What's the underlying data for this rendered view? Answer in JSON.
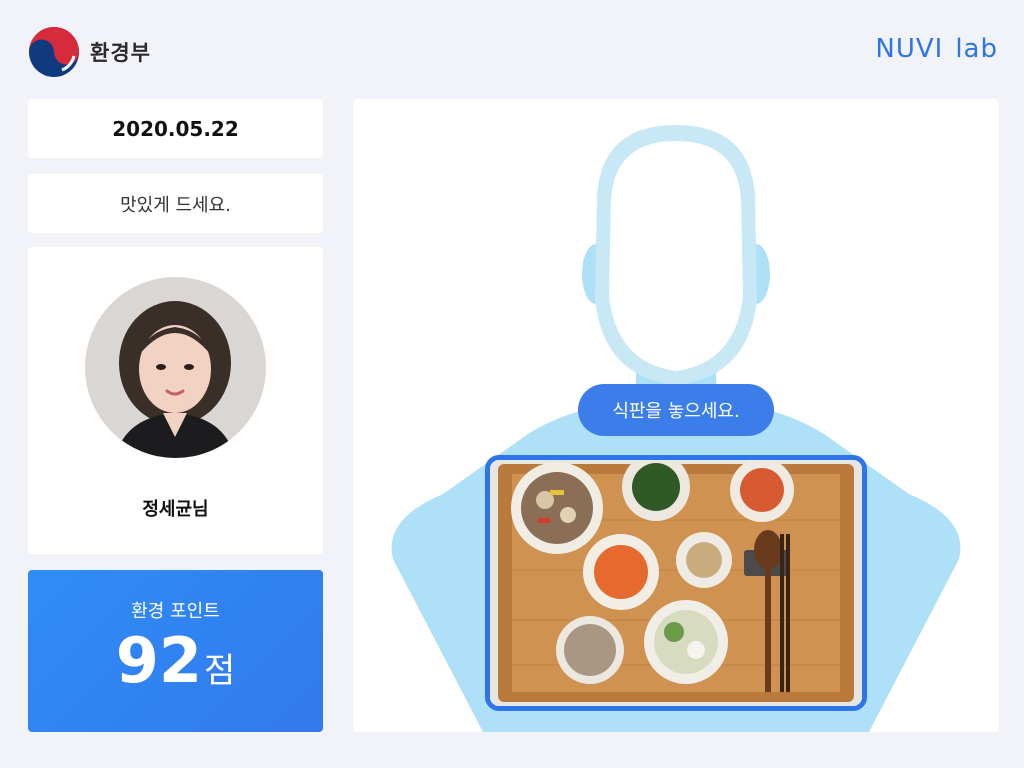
{
  "header": {
    "ministry_name": "환경부",
    "brand_part1": "NUVI",
    "brand_part2": "lab",
    "brand_color": "#2f74e8"
  },
  "date": "2020.05.22",
  "greeting": "맛있게 드세요.",
  "user": {
    "name": "정세균님"
  },
  "points": {
    "label": "환경 포인트",
    "value": "92",
    "unit": "점"
  },
  "camera": {
    "prompt": "식판을 놓으세요."
  },
  "colors": {
    "accent": "#3b7eea",
    "silhouette": "#aee0f7",
    "points_card": "#2f8df7"
  }
}
